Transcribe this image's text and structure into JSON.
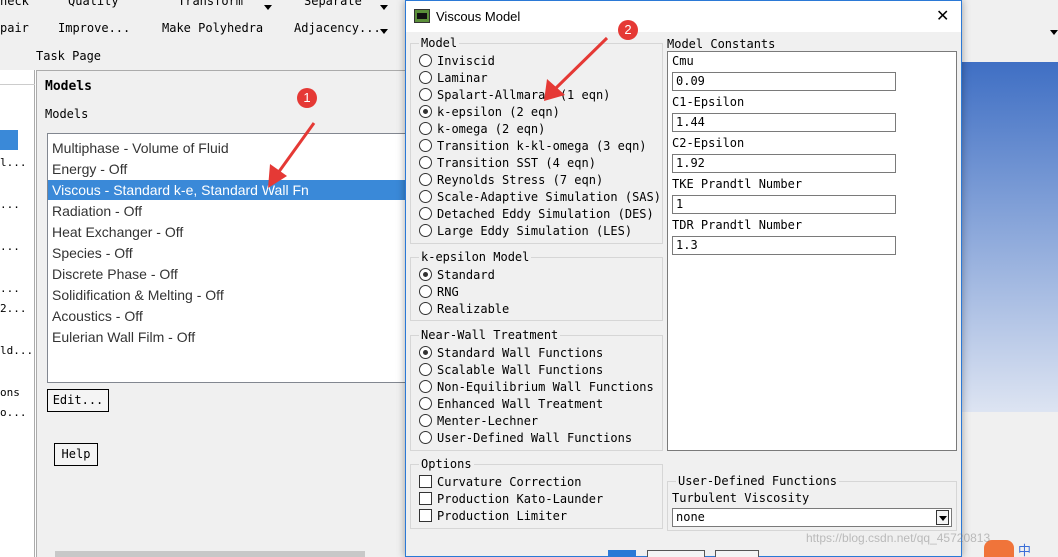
{
  "ribbon": {
    "row1": [
      "neck",
      "Quality",
      "Transform",
      "Separate",
      "Adjacency..."
    ],
    "row2": [
      "pair",
      "Improve...",
      "Make Polyhedra",
      "Adjacency..."
    ]
  },
  "task_page": {
    "header": "Task Page",
    "title": "Models",
    "subtitle": "Models",
    "models": [
      "Multiphase - Volume of Fluid",
      "Energy - Off",
      "Viscous - Standard k-e, Standard Wall Fn",
      "Radiation - Off",
      "Heat Exchanger - Off",
      "Species - Off",
      "Discrete Phase - Off",
      "Solidification & Melting - Off",
      "Acoustics - Off",
      "Eulerian Wall Film - Off"
    ],
    "selected_index": 2,
    "edit_label": "Edit...",
    "help_label": "Help"
  },
  "left_strip": [
    "l...",
    "...",
    "...",
    "...",
    "2...",
    "ld...",
    "ons",
    "o..."
  ],
  "dialog": {
    "title": "Viscous Model",
    "close_glyph": "✕",
    "model_group": {
      "title": "Model",
      "options": [
        "Inviscid",
        "Laminar",
        "Spalart-Allmaras (1 eqn)",
        "k-epsilon (2 eqn)",
        "k-omega (2 eqn)",
        "Transition k-kl-omega (3 eqn)",
        "Transition SST (4 eqn)",
        "Reynolds Stress (7 eqn)",
        "Scale-Adaptive Simulation (SAS)",
        "Detached Eddy Simulation (DES)",
        "Large Eddy Simulation (LES)"
      ],
      "selected": 3
    },
    "keps_group": {
      "title": "k-epsilon Model",
      "options": [
        "Standard",
        "RNG",
        "Realizable"
      ],
      "selected": 0
    },
    "wall_group": {
      "title": "Near-Wall Treatment",
      "options": [
        "Standard Wall Functions",
        "Scalable Wall Functions",
        "Non-Equilibrium Wall Functions",
        "Enhanced Wall Treatment",
        "Menter-Lechner",
        "User-Defined Wall Functions"
      ],
      "selected": 0
    },
    "options_group": {
      "title": "Options",
      "items": [
        "Curvature Correction",
        "Production Kato-Launder",
        "Production Limiter"
      ]
    },
    "constants": {
      "title": "Model Constants",
      "items": [
        {
          "label": "Cmu",
          "value": "0.09"
        },
        {
          "label": "C1-Epsilon",
          "value": "1.44"
        },
        {
          "label": "C2-Epsilon",
          "value": "1.92"
        },
        {
          "label": "TKE Prandtl Number",
          "value": "1"
        },
        {
          "label": "TDR Prandtl Number",
          "value": "1.3"
        }
      ]
    },
    "udf": {
      "title": "User-Defined Functions",
      "label": "Turbulent Viscosity",
      "value": "none"
    }
  },
  "annotations": {
    "badge1": "1",
    "badge2": "2"
  },
  "watermark": "https://blog.csdn.net/qq_45720813",
  "colors": {
    "selection": "#3a89d8",
    "dialog_border": "#2b79d6",
    "annotation": "#e53935"
  }
}
